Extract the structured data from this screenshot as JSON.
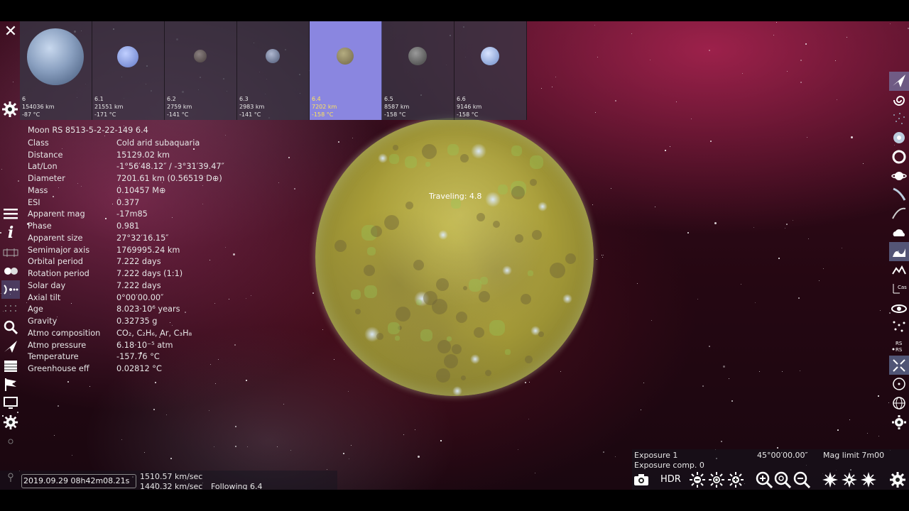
{
  "thumbnails": [
    {
      "name": "6",
      "size": "154036 km",
      "temp": "-87 °C",
      "selected": false
    },
    {
      "name": "6.1",
      "size": "21551 km",
      "temp": "-171 °C",
      "selected": false
    },
    {
      "name": "6.2",
      "size": "2759 km",
      "temp": "-141 °C",
      "selected": false
    },
    {
      "name": "6.3",
      "size": "2983 km",
      "temp": "-141 °C",
      "selected": false
    },
    {
      "name": "6.4",
      "size": "7202 km",
      "temp": "-158 °C",
      "selected": true
    },
    {
      "name": "6.5",
      "size": "8587 km",
      "temp": "-158 °C",
      "selected": false
    },
    {
      "name": "6.6",
      "size": "9146 km",
      "temp": "-158 °C",
      "selected": false
    }
  ],
  "info": {
    "title": "Moon  RS 8513-5-2-22-149 6.4",
    "rows": [
      {
        "key": "Class",
        "value": "Cold arid subaquaria"
      },
      {
        "key": "Distance",
        "value": "15129.02 km"
      },
      {
        "key": "Lat/Lon",
        "value": "-1°56′48.12″ / -3°31′39.47″"
      },
      {
        "key": "Diameter",
        "value": "7201.61 km (0.56519 D⊕)"
      },
      {
        "key": "Mass",
        "value": "0.10457 M⊕"
      },
      {
        "key": "ESI",
        "value": "0.377"
      },
      {
        "key": "Apparent mag",
        "value": "-17m85"
      },
      {
        "key": "Phase",
        "value": "0.981"
      },
      {
        "key": "Apparent size",
        "value": "27°32′16.15″"
      },
      {
        "key": "Semimajor axis",
        "value": "1769995.24 km"
      },
      {
        "key": "Orbital period",
        "value": "7.222 days"
      },
      {
        "key": "Rotation period",
        "value": "7.222 days (1:1)"
      },
      {
        "key": "Solar day",
        "value": "7.222 days"
      },
      {
        "key": "Axial tilt",
        "value": "0°00′00.00″"
      },
      {
        "key": "Age",
        "value": "8.023·10⁶ years"
      },
      {
        "key": "Gravity",
        "value": "0.32735 g"
      },
      {
        "key": "Atmo composition",
        "value": "CO₂, C₂H₆, Ar, C₃H₈"
      },
      {
        "key": "Atmo pressure",
        "value": "6.18·10⁻⁵ atm"
      },
      {
        "key": "Temperature",
        "value": "-157.76 °C"
      },
      {
        "key": "Greenhouse eff",
        "value": "0.02812 °C"
      }
    ]
  },
  "viewport": {
    "traveling": "Traveling: 4.8"
  },
  "bottom_left": {
    "date": "2019.09.29 08h42m08.21s",
    "speed1": "1510.57 km/sec",
    "speed2": "1440.32 km/sec",
    "following": "Following 6.4"
  },
  "bottom_right": {
    "exposure": "Exposure 1",
    "exposure_comp": "Exposure comp. 0",
    "fov": "45°00′00.00″",
    "mag_limit": "Mag limit 7m00",
    "hdr_label": "HDR"
  },
  "left_toolbar": [
    "menu-icon",
    "info-icon",
    "map-icon",
    "planets-icon",
    "system-icon",
    "grid-icon",
    "search-icon",
    "ship-icon",
    "calendar-icon",
    "flag-icon",
    "monitor-icon",
    "settings-icon"
  ],
  "right_toolbar": [
    "ship-icon",
    "galaxy-icon",
    "star-field-icon",
    "nebula-icon",
    "star-icon",
    "planet-icon",
    "comet-icon",
    "orbit-icon",
    "cloud-icon",
    "wave-icon",
    "terrain-icon",
    "constellation-icon",
    "eye-icon",
    "grid-dots-icon",
    "labels-icon",
    "arrows-icon",
    "circle-icon",
    "globe-icon",
    "settings-icon"
  ],
  "colors": {
    "selected_thumb": "#8a86e0",
    "selected_text": "#ffe35a",
    "panel_text": "#e6e6e6"
  }
}
